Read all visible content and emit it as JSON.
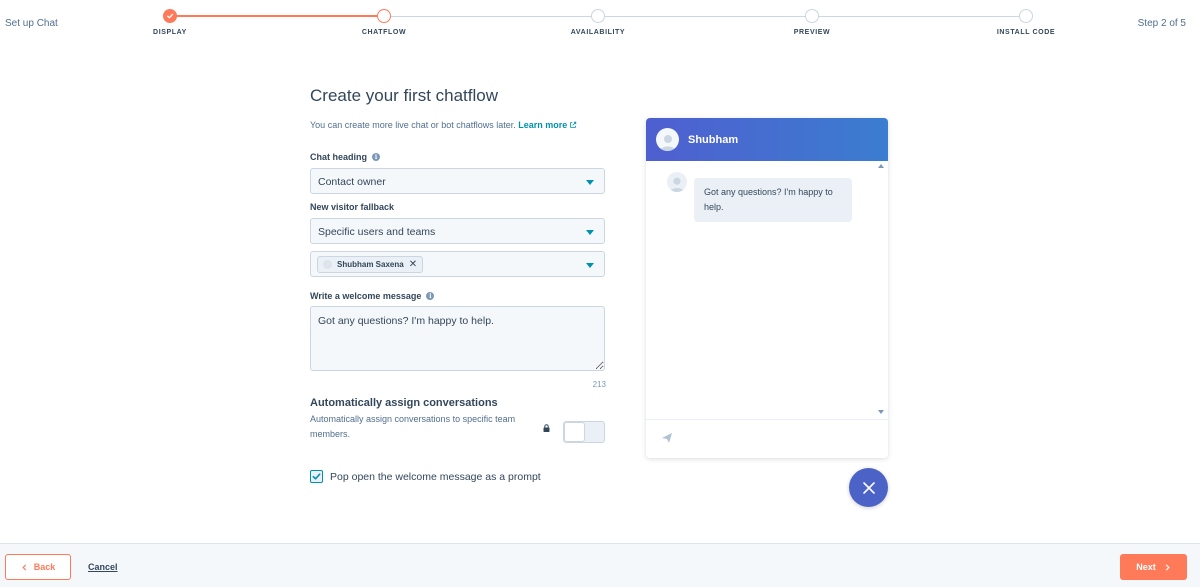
{
  "header": {
    "setup_label": "Set up Chat",
    "step_count": "Step 2 of 5",
    "steps": [
      {
        "label": "DISPLAY",
        "state": "done"
      },
      {
        "label": "CHATFLOW",
        "state": "active"
      },
      {
        "label": "AVAILABILITY",
        "state": "upcoming"
      },
      {
        "label": "PREVIEW",
        "state": "upcoming"
      },
      {
        "label": "INSTALL CODE",
        "state": "upcoming"
      }
    ]
  },
  "form": {
    "title": "Create your first chatflow",
    "subtitle": "You can create more live chat or bot chatflows later.",
    "learn_more": "Learn more",
    "chat_heading_label": "Chat heading",
    "chat_heading_value": "Contact owner",
    "fallback_label": "New visitor fallback",
    "fallback_value": "Specific users and teams",
    "fallback_user_chip": "Shubham Saxena",
    "welcome_label": "Write a welcome message",
    "welcome_value": "Got any questions? I'm happy to help.",
    "char_count": "213",
    "assign_title": "Automatically assign conversations",
    "assign_desc": "Automatically assign conversations to specific team members.",
    "assign_enabled": false,
    "popup_label": "Pop open the welcome message as a prompt",
    "popup_checked": true
  },
  "preview": {
    "agent_name": "Shubham",
    "message": "Got any questions? I'm happy to help."
  },
  "footer": {
    "back_label": "Back",
    "cancel_label": "Cancel",
    "next_label": "Next"
  },
  "colors": {
    "accent": "#ff7a59",
    "link": "#0091ae",
    "chat_header": "#4f5fd0"
  }
}
